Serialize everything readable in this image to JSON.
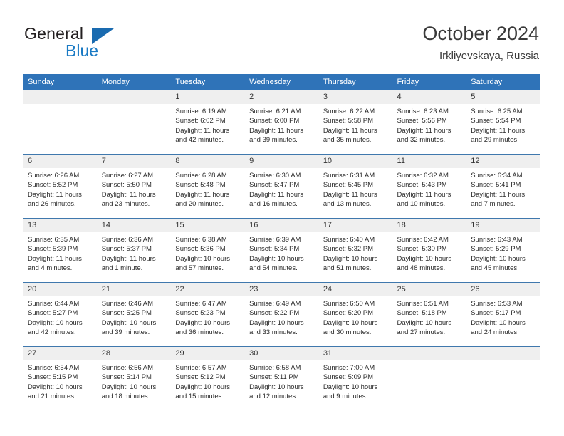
{
  "brand": {
    "name_top": "General",
    "name_bottom": "Blue",
    "triangle_color": "#1a6bb0",
    "blue_color": "#1a7ac4"
  },
  "header": {
    "title": "October 2024",
    "subtitle": "Irkliyevskaya, Russia"
  },
  "theme": {
    "header_blue": "#2f73b8",
    "daynum_band": "#efefef",
    "row_rule": "#3f78ad",
    "text": "#2b2b2b"
  },
  "weekdays": [
    "Sunday",
    "Monday",
    "Tuesday",
    "Wednesday",
    "Thursday",
    "Friday",
    "Saturday"
  ],
  "weeks": [
    [
      {
        "day": "",
        "sunrise": "",
        "sunset": "",
        "daylight_line1": "",
        "daylight_line2": ""
      },
      {
        "day": "",
        "sunrise": "",
        "sunset": "",
        "daylight_line1": "",
        "daylight_line2": ""
      },
      {
        "day": "1",
        "sunrise": "Sunrise: 6:19 AM",
        "sunset": "Sunset: 6:02 PM",
        "daylight_line1": "Daylight: 11 hours",
        "daylight_line2": "and 42 minutes."
      },
      {
        "day": "2",
        "sunrise": "Sunrise: 6:21 AM",
        "sunset": "Sunset: 6:00 PM",
        "daylight_line1": "Daylight: 11 hours",
        "daylight_line2": "and 39 minutes."
      },
      {
        "day": "3",
        "sunrise": "Sunrise: 6:22 AM",
        "sunset": "Sunset: 5:58 PM",
        "daylight_line1": "Daylight: 11 hours",
        "daylight_line2": "and 35 minutes."
      },
      {
        "day": "4",
        "sunrise": "Sunrise: 6:23 AM",
        "sunset": "Sunset: 5:56 PM",
        "daylight_line1": "Daylight: 11 hours",
        "daylight_line2": "and 32 minutes."
      },
      {
        "day": "5",
        "sunrise": "Sunrise: 6:25 AM",
        "sunset": "Sunset: 5:54 PM",
        "daylight_line1": "Daylight: 11 hours",
        "daylight_line2": "and 29 minutes."
      }
    ],
    [
      {
        "day": "6",
        "sunrise": "Sunrise: 6:26 AM",
        "sunset": "Sunset: 5:52 PM",
        "daylight_line1": "Daylight: 11 hours",
        "daylight_line2": "and 26 minutes."
      },
      {
        "day": "7",
        "sunrise": "Sunrise: 6:27 AM",
        "sunset": "Sunset: 5:50 PM",
        "daylight_line1": "Daylight: 11 hours",
        "daylight_line2": "and 23 minutes."
      },
      {
        "day": "8",
        "sunrise": "Sunrise: 6:28 AM",
        "sunset": "Sunset: 5:48 PM",
        "daylight_line1": "Daylight: 11 hours",
        "daylight_line2": "and 20 minutes."
      },
      {
        "day": "9",
        "sunrise": "Sunrise: 6:30 AM",
        "sunset": "Sunset: 5:47 PM",
        "daylight_line1": "Daylight: 11 hours",
        "daylight_line2": "and 16 minutes."
      },
      {
        "day": "10",
        "sunrise": "Sunrise: 6:31 AM",
        "sunset": "Sunset: 5:45 PM",
        "daylight_line1": "Daylight: 11 hours",
        "daylight_line2": "and 13 minutes."
      },
      {
        "day": "11",
        "sunrise": "Sunrise: 6:32 AM",
        "sunset": "Sunset: 5:43 PM",
        "daylight_line1": "Daylight: 11 hours",
        "daylight_line2": "and 10 minutes."
      },
      {
        "day": "12",
        "sunrise": "Sunrise: 6:34 AM",
        "sunset": "Sunset: 5:41 PM",
        "daylight_line1": "Daylight: 11 hours",
        "daylight_line2": "and 7 minutes."
      }
    ],
    [
      {
        "day": "13",
        "sunrise": "Sunrise: 6:35 AM",
        "sunset": "Sunset: 5:39 PM",
        "daylight_line1": "Daylight: 11 hours",
        "daylight_line2": "and 4 minutes."
      },
      {
        "day": "14",
        "sunrise": "Sunrise: 6:36 AM",
        "sunset": "Sunset: 5:37 PM",
        "daylight_line1": "Daylight: 11 hours",
        "daylight_line2": "and 1 minute."
      },
      {
        "day": "15",
        "sunrise": "Sunrise: 6:38 AM",
        "sunset": "Sunset: 5:36 PM",
        "daylight_line1": "Daylight: 10 hours",
        "daylight_line2": "and 57 minutes."
      },
      {
        "day": "16",
        "sunrise": "Sunrise: 6:39 AM",
        "sunset": "Sunset: 5:34 PM",
        "daylight_line1": "Daylight: 10 hours",
        "daylight_line2": "and 54 minutes."
      },
      {
        "day": "17",
        "sunrise": "Sunrise: 6:40 AM",
        "sunset": "Sunset: 5:32 PM",
        "daylight_line1": "Daylight: 10 hours",
        "daylight_line2": "and 51 minutes."
      },
      {
        "day": "18",
        "sunrise": "Sunrise: 6:42 AM",
        "sunset": "Sunset: 5:30 PM",
        "daylight_line1": "Daylight: 10 hours",
        "daylight_line2": "and 48 minutes."
      },
      {
        "day": "19",
        "sunrise": "Sunrise: 6:43 AM",
        "sunset": "Sunset: 5:29 PM",
        "daylight_line1": "Daylight: 10 hours",
        "daylight_line2": "and 45 minutes."
      }
    ],
    [
      {
        "day": "20",
        "sunrise": "Sunrise: 6:44 AM",
        "sunset": "Sunset: 5:27 PM",
        "daylight_line1": "Daylight: 10 hours",
        "daylight_line2": "and 42 minutes."
      },
      {
        "day": "21",
        "sunrise": "Sunrise: 6:46 AM",
        "sunset": "Sunset: 5:25 PM",
        "daylight_line1": "Daylight: 10 hours",
        "daylight_line2": "and 39 minutes."
      },
      {
        "day": "22",
        "sunrise": "Sunrise: 6:47 AM",
        "sunset": "Sunset: 5:23 PM",
        "daylight_line1": "Daylight: 10 hours",
        "daylight_line2": "and 36 minutes."
      },
      {
        "day": "23",
        "sunrise": "Sunrise: 6:49 AM",
        "sunset": "Sunset: 5:22 PM",
        "daylight_line1": "Daylight: 10 hours",
        "daylight_line2": "and 33 minutes."
      },
      {
        "day": "24",
        "sunrise": "Sunrise: 6:50 AM",
        "sunset": "Sunset: 5:20 PM",
        "daylight_line1": "Daylight: 10 hours",
        "daylight_line2": "and 30 minutes."
      },
      {
        "day": "25",
        "sunrise": "Sunrise: 6:51 AM",
        "sunset": "Sunset: 5:18 PM",
        "daylight_line1": "Daylight: 10 hours",
        "daylight_line2": "and 27 minutes."
      },
      {
        "day": "26",
        "sunrise": "Sunrise: 6:53 AM",
        "sunset": "Sunset: 5:17 PM",
        "daylight_line1": "Daylight: 10 hours",
        "daylight_line2": "and 24 minutes."
      }
    ],
    [
      {
        "day": "27",
        "sunrise": "Sunrise: 6:54 AM",
        "sunset": "Sunset: 5:15 PM",
        "daylight_line1": "Daylight: 10 hours",
        "daylight_line2": "and 21 minutes."
      },
      {
        "day": "28",
        "sunrise": "Sunrise: 6:56 AM",
        "sunset": "Sunset: 5:14 PM",
        "daylight_line1": "Daylight: 10 hours",
        "daylight_line2": "and 18 minutes."
      },
      {
        "day": "29",
        "sunrise": "Sunrise: 6:57 AM",
        "sunset": "Sunset: 5:12 PM",
        "daylight_line1": "Daylight: 10 hours",
        "daylight_line2": "and 15 minutes."
      },
      {
        "day": "30",
        "sunrise": "Sunrise: 6:58 AM",
        "sunset": "Sunset: 5:11 PM",
        "daylight_line1": "Daylight: 10 hours",
        "daylight_line2": "and 12 minutes."
      },
      {
        "day": "31",
        "sunrise": "Sunrise: 7:00 AM",
        "sunset": "Sunset: 5:09 PM",
        "daylight_line1": "Daylight: 10 hours",
        "daylight_line2": "and 9 minutes."
      },
      {
        "day": "",
        "sunrise": "",
        "sunset": "",
        "daylight_line1": "",
        "daylight_line2": ""
      },
      {
        "day": "",
        "sunrise": "",
        "sunset": "",
        "daylight_line1": "",
        "daylight_line2": ""
      }
    ]
  ]
}
